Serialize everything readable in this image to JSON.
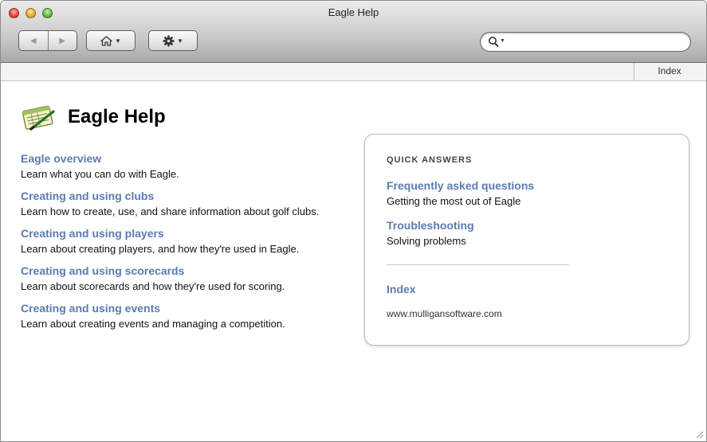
{
  "window": {
    "title": "Eagle Help"
  },
  "toolbar": {
    "back_icon": "back-arrow-icon",
    "forward_icon": "forward-arrow-icon",
    "home_icon": "home-icon",
    "gear_icon": "gear-icon",
    "search_icon": "search-icon",
    "search_value": ""
  },
  "subbar": {
    "index_label": "Index"
  },
  "page": {
    "title": "Eagle Help",
    "topics": [
      {
        "title": "Eagle overview",
        "desc": "Learn what you can do with Eagle."
      },
      {
        "title": "Creating and using clubs",
        "desc": "Learn how to create, use, and share information about golf clubs."
      },
      {
        "title": "Creating and using players",
        "desc": "Learn about creating players, and how they're used in Eagle."
      },
      {
        "title": "Creating and using scorecards",
        "desc": "Learn about scorecards and how they're used for scoring."
      },
      {
        "title": "Creating and using events",
        "desc": "Learn about creating events and managing a competition."
      }
    ]
  },
  "quick_answers": {
    "heading": "QUICK ANSWERS",
    "items": [
      {
        "title": "Frequently asked questions",
        "desc": "Getting the most out of Eagle"
      },
      {
        "title": "Troubleshooting",
        "desc": "Solving problems"
      }
    ],
    "index_label": "Index",
    "url": "www.mulligansoftware.com"
  },
  "colors": {
    "link": "#5b7bb1",
    "text": "#111111"
  }
}
